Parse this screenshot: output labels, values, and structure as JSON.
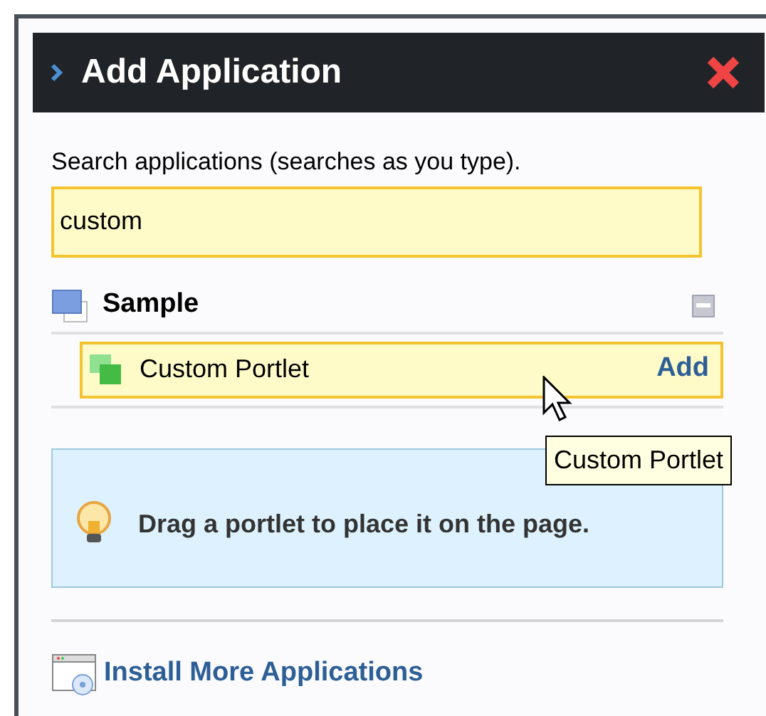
{
  "window": {
    "title": "Add Application"
  },
  "search": {
    "label": "Search applications (searches as you type).",
    "value": "custom"
  },
  "categories": [
    {
      "name": "Sample",
      "expanded": true,
      "items": [
        {
          "name": "Custom Portlet",
          "action": "Add",
          "selected": true
        }
      ]
    }
  ],
  "tooltip": "Custom Portlet",
  "message": "Drag a portlet to place it on the page.",
  "install_link": "Install More Applications"
}
